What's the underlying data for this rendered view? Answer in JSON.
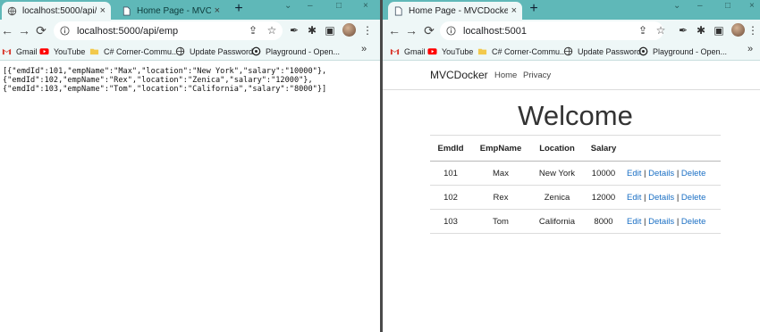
{
  "left": {
    "tabs": [
      {
        "title": "localhost:5000/api/emp",
        "active": true
      },
      {
        "title": "Home Page - MVCDocke",
        "active": false
      }
    ],
    "address": "localhost:5000/api/emp",
    "bookmarks": [
      "Gmail",
      "YouTube",
      "C# Corner-Commu...",
      "Update Password",
      "Playground - Open..."
    ],
    "bookmarks_more": "»",
    "json_lines": [
      "[{\"emdId\":101,\"empName\":\"Max\",\"location\":\"New York\",\"salary\":\"10000\"},",
      "{\"emdId\":102,\"empName\":\"Rex\",\"location\":\"Zenica\",\"salary\":\"12000\"},",
      "{\"emdId\":103,\"empName\":\"Tom\",\"location\":\"California\",\"salary\":\"8000\"}]"
    ]
  },
  "right": {
    "tabs": [
      {
        "title": "Home Page - MVCDocker",
        "active": true
      }
    ],
    "address": "localhost:5001",
    "bookmarks": [
      "Gmail",
      "YouTube",
      "C# Corner-Commu...",
      "Update Password",
      "Playground - Open..."
    ],
    "bookmarks_more": "»",
    "site": {
      "brand": "MVCDocker",
      "nav": [
        "Home",
        "Privacy"
      ],
      "heading": "Welcome",
      "columns": [
        "EmdId",
        "EmpName",
        "Location",
        "Salary",
        ""
      ],
      "rows": [
        {
          "id": "101",
          "name": "Max",
          "location": "New York",
          "salary": "10000"
        },
        {
          "id": "102",
          "name": "Rex",
          "location": "Zenica",
          "salary": "12000"
        },
        {
          "id": "103",
          "name": "Tom",
          "location": "California",
          "salary": "8000"
        }
      ],
      "actions": {
        "edit": "Edit",
        "details": "Details",
        "delete": "Delete",
        "sep": "|"
      }
    }
  },
  "icons": {
    "new_tab": "+",
    "close_tab": "×",
    "back": "←",
    "forward": "→",
    "reload": "⟳",
    "share": "⇪",
    "star": "☆",
    "menu": "⋮",
    "minimize": "–",
    "maximize": "□"
  },
  "colors": {
    "tabstrip": "#5fb8b8",
    "toolbar": "#eef7f7",
    "link": "#1a6fc4"
  }
}
